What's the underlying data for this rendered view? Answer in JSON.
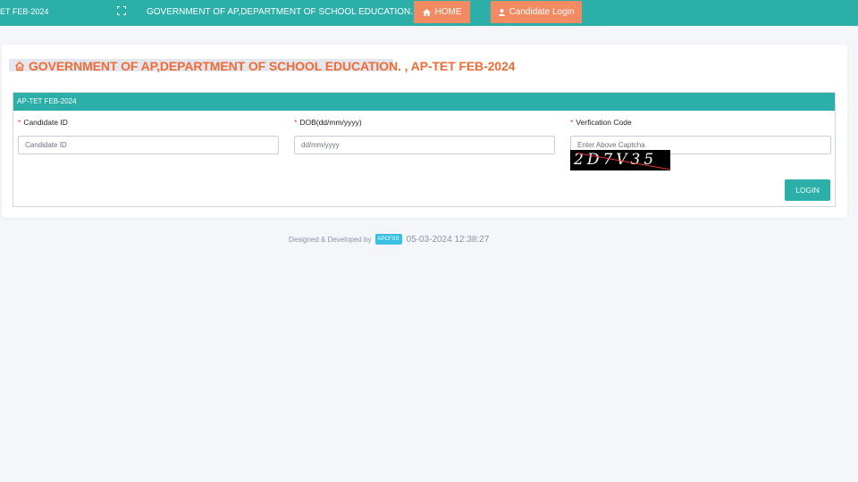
{
  "topbar": {
    "brand": "ET FEB-2024",
    "title": "GOVERNMENT OF AP,DEPARTMENT OF SCHOOL EDUCATION.",
    "home_label": "HOME",
    "candidate_login_label": "Candidate Login",
    "color": "#2bafa8",
    "button_color": "#f28a62",
    "icons": [
      "expand-icon",
      "home-icon",
      "user-icon"
    ]
  },
  "page": {
    "title": "GOVERNMENT OF AP,DEPARTMENT OF SCHOOL EDUCATION. , AP-TET FEB-2024",
    "title_color": "#f26b35"
  },
  "panel": {
    "heading": "AP-TET FEB-2024",
    "fields": [
      {
        "label": "Candidate ID",
        "placeholder": "Candidate ID",
        "value": ""
      },
      {
        "label": "DOB(dd/mm/yyyy)",
        "placeholder": "dd/mm/yyyy",
        "value": ""
      },
      {
        "label": "Verfication Code",
        "placeholder": "Enter Above Captcha",
        "value": ""
      }
    ],
    "required_marker": "*",
    "captcha_text": "2D7V35",
    "login_label": "LOGIN"
  },
  "footer": {
    "designed_by": "Designed & Developed by",
    "badge": "APCFSS",
    "timestamp": "05-03-2024 12:38:27"
  }
}
